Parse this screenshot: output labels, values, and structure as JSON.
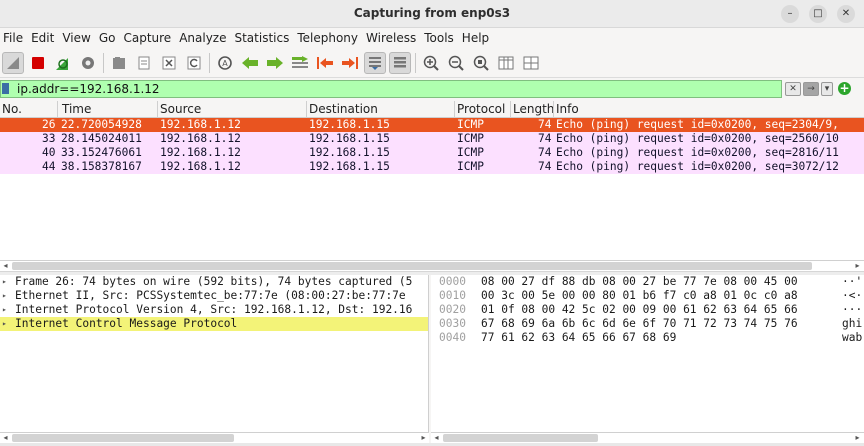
{
  "window": {
    "title": "Capturing from enp0s3",
    "buttons": [
      "–",
      "□",
      "✕"
    ]
  },
  "menu": [
    "File",
    "Edit",
    "View",
    "Go",
    "Capture",
    "Analyze",
    "Statistics",
    "Telephony",
    "Wireless",
    "Tools",
    "Help"
  ],
  "toolbar": {
    "icons": [
      "shark-fin-start-icon",
      "stop-capture-icon",
      "restart-capture-icon",
      "capture-options-icon",
      "open-file-icon",
      "save-file-icon",
      "close-file-icon",
      "reload-file-icon",
      "find-packet-icon",
      "go-back-icon",
      "go-forward-icon",
      "go-to-packet-icon",
      "go-first-icon",
      "go-last-icon",
      "auto-scroll-icon",
      "colorize-icon",
      "zoom-in-icon",
      "zoom-out-icon",
      "zoom-normal-icon",
      "resize-columns-icon",
      "layout-icon"
    ]
  },
  "filter": {
    "value": "ip.addr==192.168.1.12",
    "color": "#afffaf"
  },
  "packet_list": {
    "columns": [
      "No.",
      "Time",
      "Source",
      "Destination",
      "Protocol",
      "Length",
      "Info"
    ],
    "rows": [
      {
        "no": "26",
        "time": "22.720054928",
        "src": "192.168.1.12",
        "dst": "192.168.1.15",
        "proto": "ICMP",
        "len": "74",
        "info": "Echo (ping) request  id=0x0200, seq=2304/9,",
        "selected": true
      },
      {
        "no": "33",
        "time": "28.145024011",
        "src": "192.168.1.12",
        "dst": "192.168.1.15",
        "proto": "ICMP",
        "len": "74",
        "info": "Echo (ping) request  id=0x0200, seq=2560/10",
        "selected": false
      },
      {
        "no": "40",
        "time": "33.152476061",
        "src": "192.168.1.12",
        "dst": "192.168.1.15",
        "proto": "ICMP",
        "len": "74",
        "info": "Echo (ping) request  id=0x0200, seq=2816/11",
        "selected": false
      },
      {
        "no": "44",
        "time": "38.158378167",
        "src": "192.168.1.12",
        "dst": "192.168.1.15",
        "proto": "ICMP",
        "len": "74",
        "info": "Echo (ping) request  id=0x0200, seq=3072/12",
        "selected": false
      }
    ],
    "selected_color": "#e95420",
    "row_color": "#fce0ff"
  },
  "details": [
    {
      "text": "Frame 26: 74 bytes on wire (592 bits), 74 bytes captured (5",
      "highlight": false
    },
    {
      "text": "Ethernet II, Src: PCSSystemtec_be:77:7e (08:00:27:be:77:7e",
      "highlight": false
    },
    {
      "text": "Internet Protocol Version 4, Src: 192.168.1.12, Dst: 192.16",
      "highlight": false
    },
    {
      "text": "Internet Control Message Protocol",
      "highlight": true
    }
  ],
  "bytes": [
    {
      "offset": "0000",
      "hex": "08 00 27 df 88 db 08 00  27 be 77 7e 08 00 45 00",
      "ascii": "··'"
    },
    {
      "offset": "0010",
      "hex": "00 3c 00 5e 00 00 80 01  b6 f7 c0 a8 01 0c c0 a8",
      "ascii": "·<·"
    },
    {
      "offset": "0020",
      "hex": "01 0f 08 00 42 5c 02 00  09 00 61 62 63 64 65 66",
      "ascii": "···"
    },
    {
      "offset": "0030",
      "hex": "67 68 69 6a 6b 6c 6d 6e  6f 70 71 72 73 74 75 76",
      "ascii": "ghi"
    },
    {
      "offset": "0040",
      "hex": "77 61 62 63 64 65 66 67  68 69",
      "ascii": "wab"
    }
  ]
}
